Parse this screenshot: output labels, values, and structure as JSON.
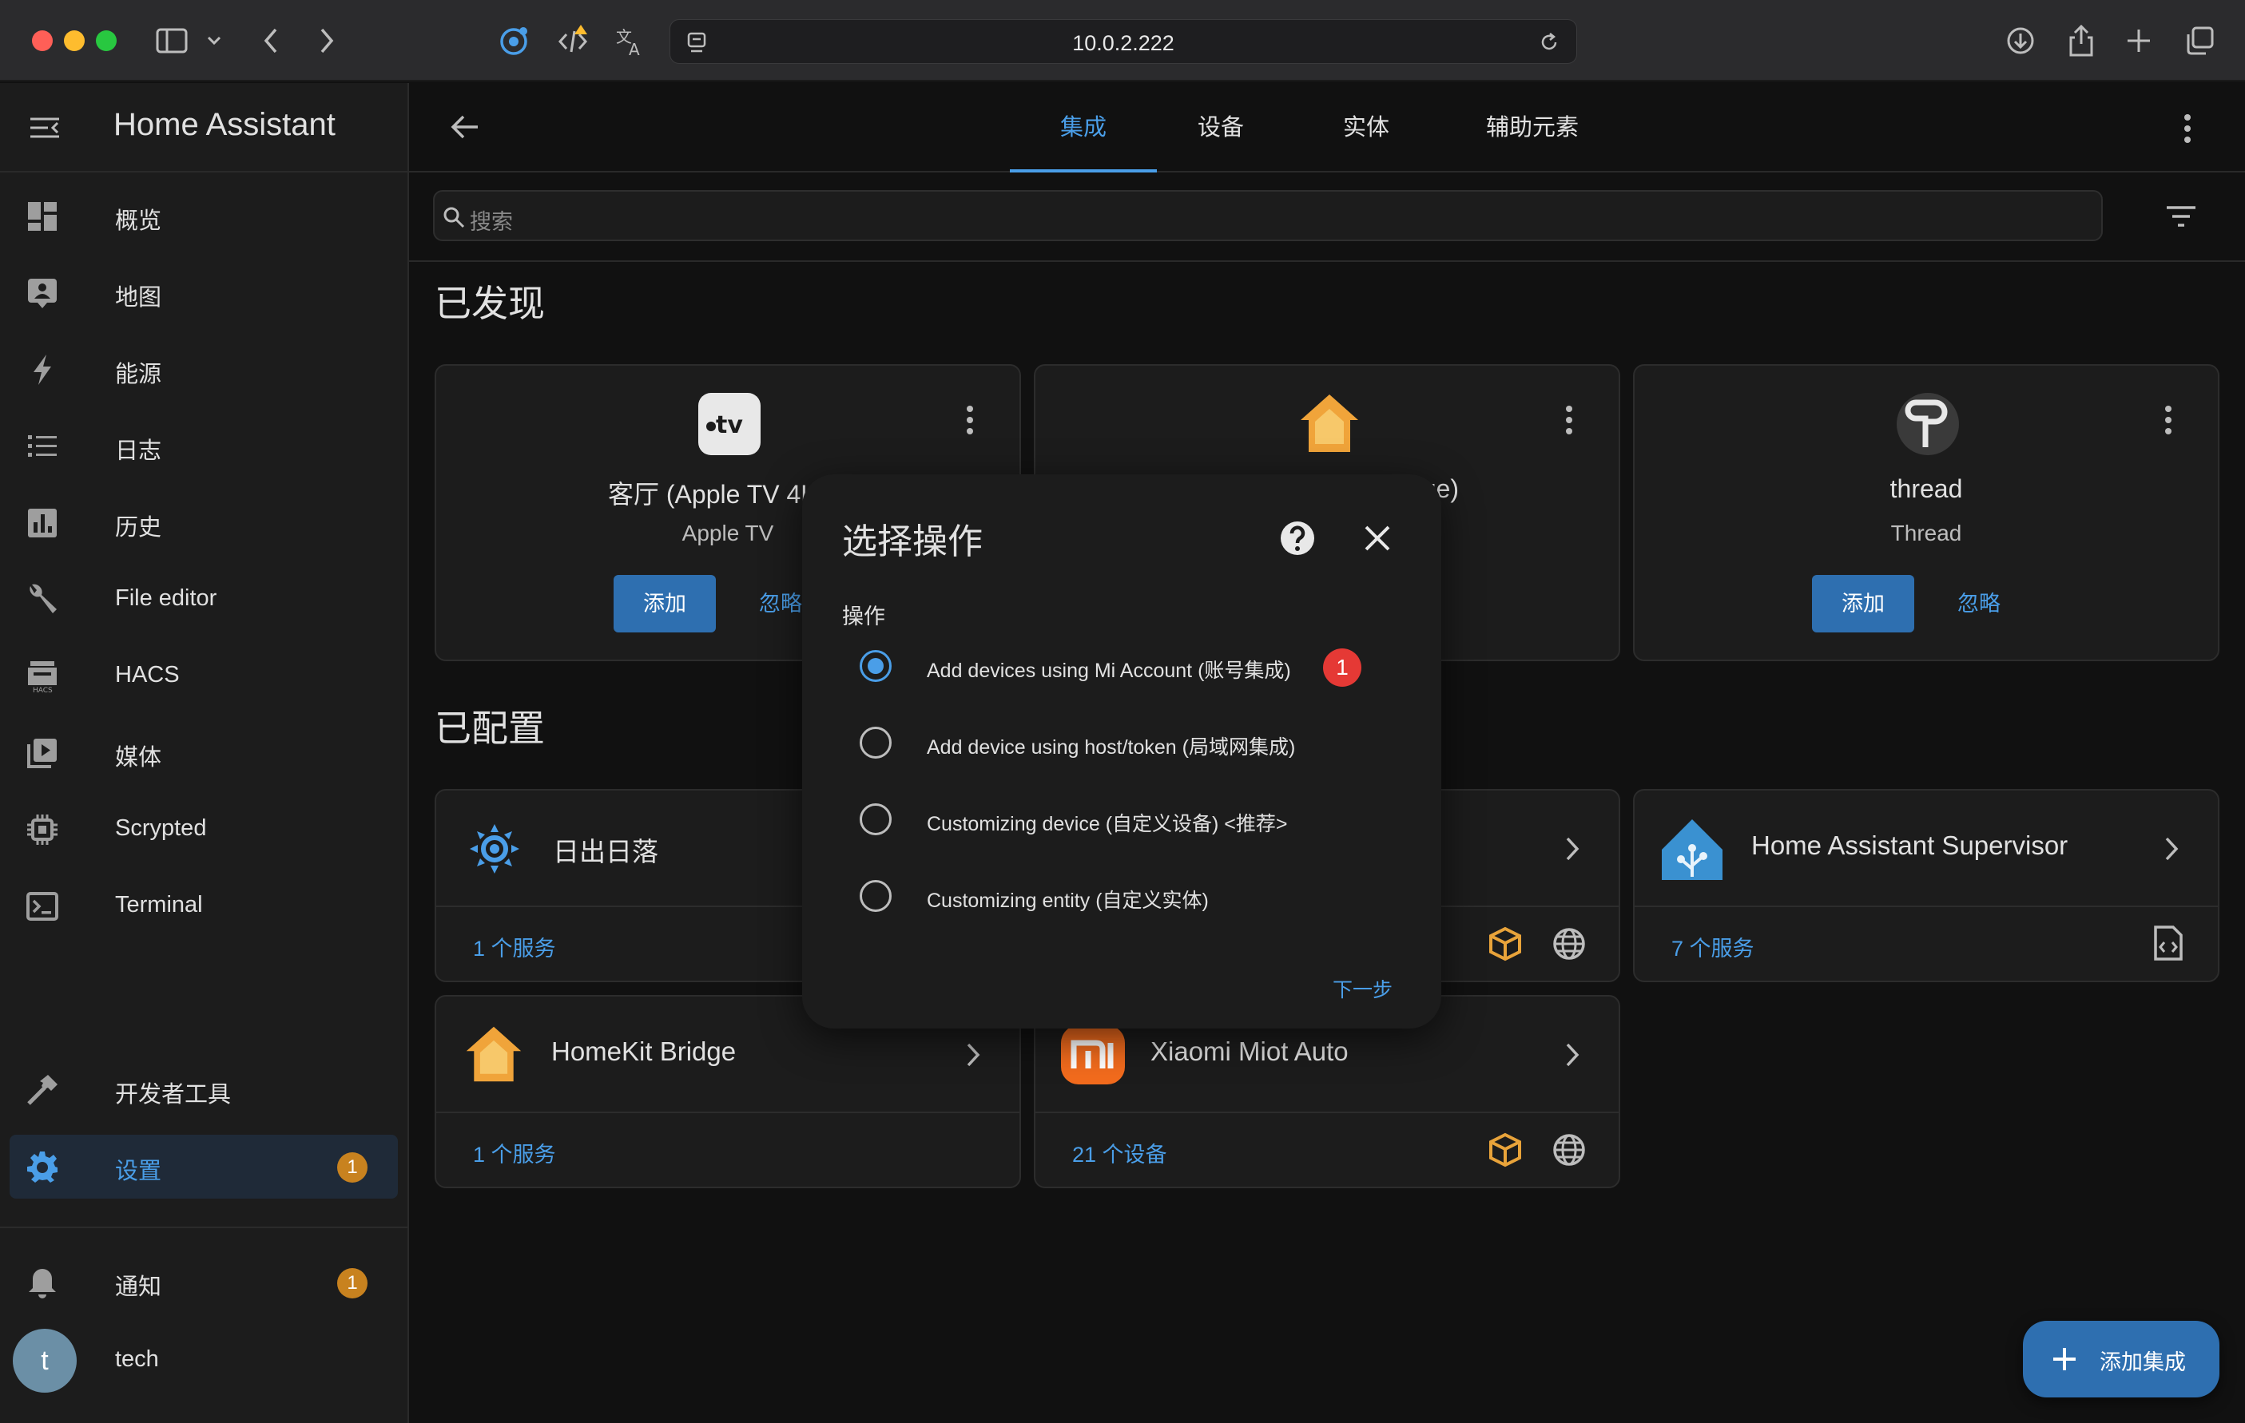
{
  "browser": {
    "url": "10.0.2.222"
  },
  "sidebar": {
    "title": "Home Assistant",
    "items": [
      {
        "label": "概览"
      },
      {
        "label": "地图"
      },
      {
        "label": "能源"
      },
      {
        "label": "日志"
      },
      {
        "label": "历史"
      },
      {
        "label": "File editor"
      },
      {
        "label": "HACS"
      },
      {
        "label": "媒体"
      },
      {
        "label": "Scrypted"
      },
      {
        "label": "Terminal"
      }
    ],
    "dev_tools": "开发者工具",
    "settings": {
      "label": "设置",
      "badge": "1"
    },
    "notifications": {
      "label": "通知",
      "badge": "1"
    },
    "user": {
      "initial": "t",
      "name": "tech"
    }
  },
  "tabs": [
    {
      "label": "集成",
      "active": true
    },
    {
      "label": "设备"
    },
    {
      "label": "实体"
    },
    {
      "label": "辅助元素"
    }
  ],
  "search": {
    "placeholder": "搜索"
  },
  "discovered": {
    "title": "已发现",
    "cards": [
      {
        "name": "客厅 (Apple TV 4K (g",
        "subtitle": "Apple TV",
        "add": "添加",
        "ignore": "忽略",
        "icon": "apple-tv-icon"
      },
      {
        "name": "ge)",
        "icon": "homekit-icon"
      },
      {
        "name": "thread",
        "subtitle": "Thread",
        "add": "添加",
        "ignore": "忽略",
        "icon": "thread-icon"
      }
    ]
  },
  "configured": {
    "title": "已配置",
    "cards": [
      {
        "name": "日出日落",
        "footer": "1 个服务",
        "icon": "sun-icon"
      },
      {
        "name": "",
        "icon": ""
      },
      {
        "name": "Home Assistant Supervisor",
        "footer": "7 个服务",
        "icon": "home-assistant-icon"
      },
      {
        "name": "HomeKit Bridge",
        "footer": "1 个服务",
        "icon": "homekit-icon"
      },
      {
        "name": "Xiaomi Miot Auto",
        "footer": "21 个设备",
        "icon": "xiaomi-icon"
      }
    ]
  },
  "dialog": {
    "title": "选择操作",
    "section_label": "操作",
    "options": [
      {
        "label": "Add devices using Mi Account (账号集成)",
        "checked": true,
        "badge": "1"
      },
      {
        "label": "Add device using host/token (局域网集成)"
      },
      {
        "label": "Customizing device (自定义设备) <推荐>"
      },
      {
        "label": "Customizing entity (自定义实体)"
      }
    ],
    "next": "下一步"
  },
  "fab": {
    "label": "添加集成"
  },
  "colors": {
    "accent": "#4a9ee8",
    "primary_button": "#2e6fb0",
    "badge_orange": "#c8821f",
    "badge_red": "#e53935",
    "background": "#111111",
    "card": "#1c1c1c"
  }
}
